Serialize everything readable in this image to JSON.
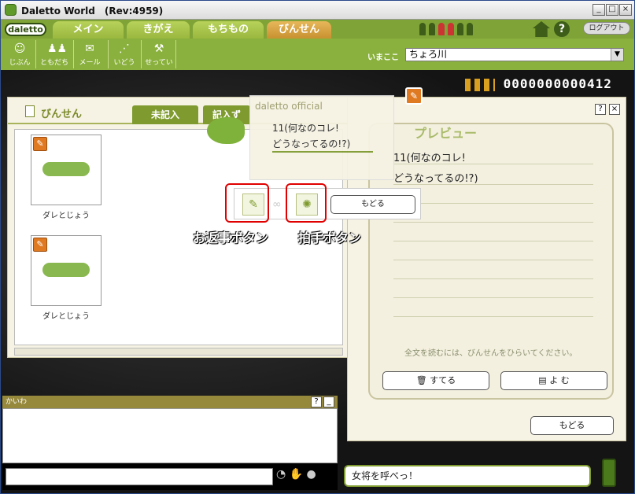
{
  "window": {
    "title": "Daletto World　(Rev:4959)",
    "min": "_",
    "max": "□",
    "close": "×"
  },
  "logo": "daletto",
  "tabs": [
    "メイン",
    "きがえ",
    "もちもの",
    "びんせん"
  ],
  "logout": "ログアウト",
  "tools": [
    {
      "label": "じぶん",
      "icon": "person-icon"
    },
    {
      "label": "ともだち",
      "icon": "friends-icon"
    },
    {
      "label": "メール",
      "icon": "mail-icon"
    },
    {
      "label": "いどう",
      "icon": "move-icon"
    },
    {
      "label": "せってい",
      "icon": "wrench-icon"
    }
  ],
  "location": {
    "label": "いまここ",
    "value": "ちょろ川"
  },
  "counter": "0000000000412",
  "left_panel": {
    "title": "びんせん",
    "tabs": [
      "未記入",
      "記入ず"
    ],
    "cards": [
      {
        "label": "ダレとじょう"
      },
      {
        "label": "ダレとじょう"
      }
    ]
  },
  "right_panel": {
    "title": "プレビュー",
    "help": "?",
    "close": "×",
    "lines": [
      "11(何なのコレ!",
      "どうなってるの!?)"
    ],
    "hint": "全文を読むには、びんせんをひらいてください。",
    "discard": "すてる",
    "read": "よ む",
    "back": "もどる"
  },
  "popup": {
    "sender": "daletto official",
    "lines": [
      "11(何なのコレ!",
      "どうなってるの!?)"
    ]
  },
  "action_bar": {
    "back": "もどる"
  },
  "annotations": {
    "reply": "お返事ボタン",
    "clap": "拍手ボタン"
  },
  "chat": {
    "title": "かいわ",
    "help": "?",
    "minimize": "_"
  },
  "npc_message": "女将を呼べっ！"
}
